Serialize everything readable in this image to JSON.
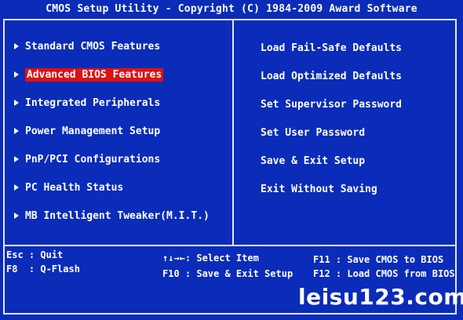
{
  "header": {
    "title": "CMOS Setup Utility - Copyright (C) 1984-2009 Award Software"
  },
  "left_menu": {
    "items": [
      {
        "label": "Standard CMOS Features",
        "selected": false
      },
      {
        "label": "Advanced BIOS Features",
        "selected": true
      },
      {
        "label": "Integrated Peripherals",
        "selected": false
      },
      {
        "label": "Power Management Setup",
        "selected": false
      },
      {
        "label": "PnP/PCI Configurations",
        "selected": false
      },
      {
        "label": "PC Health Status",
        "selected": false
      },
      {
        "label": "MB Intelligent Tweaker(M.I.T.)",
        "selected": false
      }
    ]
  },
  "right_menu": {
    "items": [
      {
        "label": "Load Fail-Safe Defaults"
      },
      {
        "label": "Load Optimized Defaults"
      },
      {
        "label": "Set Supervisor Password"
      },
      {
        "label": "Set User Password"
      },
      {
        "label": "Save & Exit Setup"
      },
      {
        "label": "Exit Without Saving"
      }
    ]
  },
  "footer": {
    "esc_quit": "Esc : Quit",
    "f8_qflash": "F8  : Q-Flash",
    "select_item": "↑↓→←: Select Item",
    "f10_save_exit": "F10 : Save & Exit Setup",
    "f11_save_cmos": "F11 : Save CMOS to BIOS",
    "f12_load_cmos": "F12 : Load CMOS from BIOS"
  },
  "watermark": {
    "text": "leisu123.com"
  },
  "colors": {
    "background": "#0a2cb8",
    "border": "#e6e6e6",
    "highlight": "#e01010",
    "text": "#ffffff"
  }
}
